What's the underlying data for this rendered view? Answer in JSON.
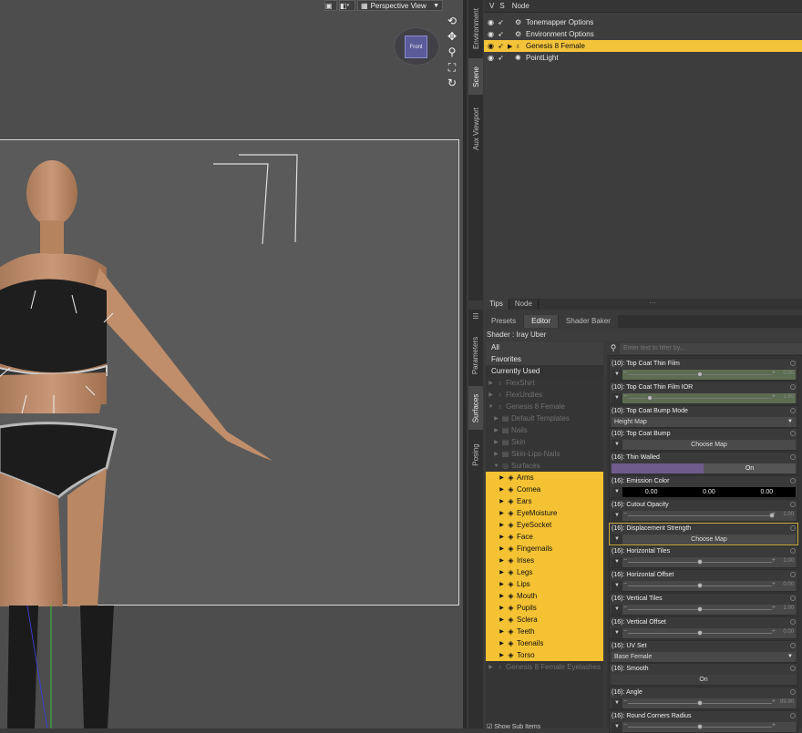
{
  "viewport": {
    "view_label": "Perspective View",
    "view_caret": "▼",
    "gizmo_label": "Front",
    "vp_icons": [
      "render-icon",
      "camera-icon"
    ],
    "tools": [
      "rotate-icon",
      "move-icon",
      "zoom-icon",
      "frame-icon",
      "reset-icon"
    ]
  },
  "left_tabs": [
    "Environment",
    "Scene",
    "Aux Viewport"
  ],
  "side_tabs": [
    "Parameters",
    "Surfaces",
    "Posing"
  ],
  "scene": {
    "header": [
      "V",
      "S",
      "Node"
    ],
    "nodes": [
      {
        "label": "Tonemapper Options",
        "selected": false,
        "icon": "tonemapper-icon"
      },
      {
        "label": "Environment Options",
        "selected": false,
        "icon": "environment-icon"
      },
      {
        "label": "Genesis 8 Female",
        "selected": true,
        "icon": "figure-icon"
      },
      {
        "label": "PointLight",
        "selected": false,
        "icon": "pointlight-icon"
      }
    ]
  },
  "bottom_tabs": [
    "Tips",
    "Node"
  ],
  "tabs": [
    "Presets",
    "Editor",
    "Shader Baker"
  ],
  "shader_label": "Shader : Iray Uber",
  "tree": {
    "top": [
      "All",
      "Favorites",
      "Currently Used"
    ],
    "items": [
      {
        "label": "FlexShirt",
        "level": 0,
        "dim": true,
        "hl": false,
        "icon": "figure"
      },
      {
        "label": "FlexUndies",
        "level": 0,
        "dim": true,
        "hl": false,
        "icon": "figure"
      },
      {
        "label": "Genesis 8 Female",
        "level": 0,
        "dim": true,
        "hl": false,
        "icon": "figure",
        "open": true
      },
      {
        "label": "Default Templates",
        "level": 1,
        "dim": true,
        "hl": false,
        "icon": "folder"
      },
      {
        "label": "Nails",
        "level": 1,
        "dim": true,
        "hl": false,
        "icon": "folder"
      },
      {
        "label": "Skin",
        "level": 1,
        "dim": true,
        "hl": false,
        "icon": "folder"
      },
      {
        "label": "Skin-Lips-Nails",
        "level": 1,
        "dim": true,
        "hl": false,
        "icon": "folder"
      },
      {
        "label": "Surfaces",
        "level": 1,
        "dim": true,
        "hl": false,
        "icon": "surface",
        "open": true
      },
      {
        "label": "Arms",
        "level": 2,
        "dim": false,
        "hl": true,
        "icon": "mat"
      },
      {
        "label": "Cornea",
        "level": 2,
        "dim": false,
        "hl": true,
        "icon": "mat"
      },
      {
        "label": "Ears",
        "level": 2,
        "dim": false,
        "hl": true,
        "icon": "mat"
      },
      {
        "label": "EyeMoisture",
        "level": 2,
        "dim": false,
        "hl": true,
        "icon": "mat"
      },
      {
        "label": "EyeSocket",
        "level": 2,
        "dim": false,
        "hl": true,
        "icon": "mat"
      },
      {
        "label": "Face",
        "level": 2,
        "dim": false,
        "hl": true,
        "icon": "mat"
      },
      {
        "label": "Fingernails",
        "level": 2,
        "dim": false,
        "hl": true,
        "icon": "mat"
      },
      {
        "label": "Irises",
        "level": 2,
        "dim": false,
        "hl": true,
        "icon": "mat"
      },
      {
        "label": "Legs",
        "level": 2,
        "dim": false,
        "hl": true,
        "icon": "mat"
      },
      {
        "label": "Lips",
        "level": 2,
        "dim": false,
        "hl": true,
        "icon": "mat"
      },
      {
        "label": "Mouth",
        "level": 2,
        "dim": false,
        "hl": true,
        "icon": "mat"
      },
      {
        "label": "Pupils",
        "level": 2,
        "dim": false,
        "hl": true,
        "icon": "mat"
      },
      {
        "label": "Sclera",
        "level": 2,
        "dim": false,
        "hl": true,
        "icon": "mat"
      },
      {
        "label": "Teeth",
        "level": 2,
        "dim": false,
        "hl": true,
        "icon": "mat"
      },
      {
        "label": "Toenails",
        "level": 2,
        "dim": false,
        "hl": true,
        "icon": "mat"
      },
      {
        "label": "Torso",
        "level": 2,
        "dim": false,
        "hl": true,
        "icon": "mat"
      },
      {
        "label": "Genesis 8 Female Eyelashes",
        "level": 0,
        "dim": true,
        "hl": false,
        "icon": "figure"
      }
    ],
    "show_sub": "Show Sub Items"
  },
  "filter_placeholder": "Enter text to filter by...",
  "properties": [
    {
      "label": "(10): Top Coat Thin Film",
      "type": "slider",
      "value": "0.00",
      "level": 0.5,
      "green": true
    },
    {
      "label": "(10): Top Coat Thin Film IOR",
      "type": "slider",
      "value": "1.50",
      "level": 0.15,
      "green": true
    },
    {
      "label": "(10): Top Coat Bump Mode",
      "type": "select",
      "value": "Height Map"
    },
    {
      "label": "(10): Top Coat Bump",
      "type": "button",
      "value": "Choose Map"
    },
    {
      "label": "(16): Thin Walled",
      "type": "toggle",
      "value": "On"
    },
    {
      "label": "(16): Emission Color",
      "type": "color",
      "values": [
        "0.00",
        "0.00",
        "0.00"
      ]
    },
    {
      "label": "(16): Cutout Opacity",
      "type": "slider",
      "value": "1.00",
      "level": 1.0,
      "green": false
    },
    {
      "label": "(16): Displacement Strength",
      "type": "button",
      "value": "Choose Map",
      "bordered": true
    },
    {
      "label": "(16): Horizontal Tiles",
      "type": "slider",
      "value": "1.00",
      "level": 0.5,
      "green": false
    },
    {
      "label": "(16): Horizontal Offset",
      "type": "slider",
      "value": "0.00",
      "level": 0.5,
      "green": false
    },
    {
      "label": "(16): Vertical Tiles",
      "type": "slider",
      "value": "1.00",
      "level": 0.5,
      "green": false
    },
    {
      "label": "(16): Vertical Offset",
      "type": "slider",
      "value": "0.00",
      "level": 0.5,
      "green": false
    },
    {
      "label": "(16): UV Set",
      "type": "select",
      "value": "Base Female"
    },
    {
      "label": "(16): Smooth",
      "type": "button",
      "value": "On"
    },
    {
      "label": "(16): Angle",
      "type": "slider",
      "value": "89.90",
      "level": 0.5,
      "green": false
    },
    {
      "label": "(16): Round Corners Radius",
      "type": "slider",
      "value": "",
      "level": 0.5,
      "green": false
    }
  ]
}
